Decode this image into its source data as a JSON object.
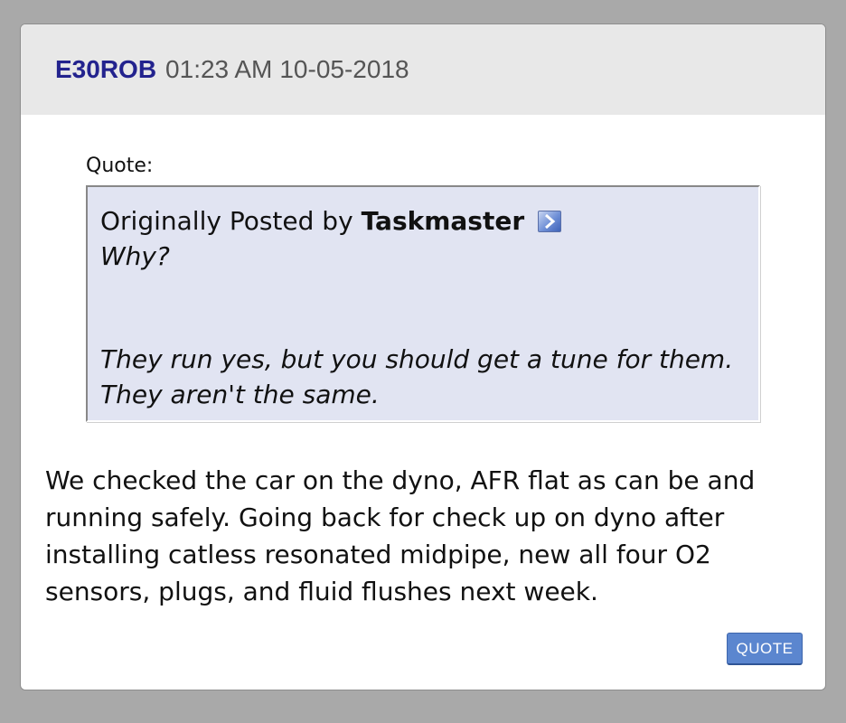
{
  "post": {
    "author": "E30ROB",
    "time": "01:23 AM",
    "date": "10-05-2018",
    "quote": {
      "label": "Quote:",
      "originally_posted_by": "Originally Posted by",
      "author": "Taskmaster",
      "view_post_icon": "arrow-right-icon",
      "line1": "Why?",
      "line2": "They run yes, but you should get a tune for them. They aren't the same."
    },
    "body": "We checked the car on the dyno, AFR flat as can be and running safely. Going back for check up on dyno after installing catless resonated midpipe, new all four O2 sensors, plugs, and fluid flushes next week.",
    "quote_button_label": "QUOTE"
  },
  "colors": {
    "page_background": "#a9a9a9",
    "header_background": "#e8e8e8",
    "author_color": "#23238e",
    "quote_background": "#e1e4f2",
    "button_color": "#5b86cf"
  }
}
